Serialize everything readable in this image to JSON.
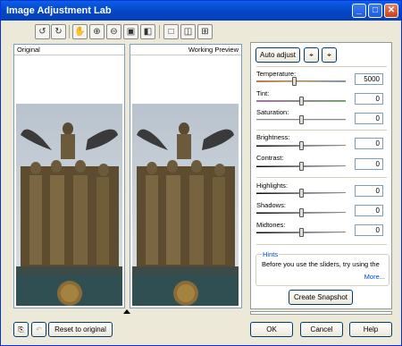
{
  "window": {
    "title": "Image Adjustment Lab"
  },
  "titlebar_buttons": {
    "minimize": "_",
    "maximize": "□",
    "close": "✕"
  },
  "toolbar": {
    "icons": [
      "rotate-left-icon",
      "rotate-right-icon",
      "hand-pan-icon",
      "zoom-in-icon",
      "zoom-out-icon",
      "fit-window-icon",
      "actual-size-icon",
      "single-view-icon",
      "split-view-icon",
      "side-by-side-icon"
    ]
  },
  "panes": {
    "original_label": "Original",
    "preview_label": "Working Preview"
  },
  "controls": {
    "auto_adjust": "Auto adjust",
    "temperature": {
      "label": "Temperature:",
      "value": "5000",
      "level": 0.42
    },
    "tint": {
      "label": "Tint:",
      "value": "0",
      "level": 0.5
    },
    "saturation": {
      "label": "Saturation:",
      "value": "0",
      "level": 0.5
    },
    "brightness": {
      "label": "Brightness:",
      "value": "0",
      "level": 0.5
    },
    "contrast": {
      "label": "Contrast:",
      "value": "0",
      "level": 0.5
    },
    "highlights": {
      "label": "Highlights:",
      "value": "0",
      "level": 0.5
    },
    "shadows": {
      "label": "Shadows:",
      "value": "0",
      "level": 0.5
    },
    "midtones": {
      "label": "Midtones:",
      "value": "0",
      "level": 0.5
    }
  },
  "hints": {
    "title": "Hints",
    "text": "Before you use the sliders, try using the",
    "more": "More..."
  },
  "buttons": {
    "create_snapshot": "Create Snapshot",
    "reset": "Reset to original",
    "ok": "OK",
    "cancel": "Cancel",
    "help": "Help"
  },
  "colors": {
    "titlebar": "#0546c8",
    "accent": "#0046d5",
    "dialog_bg": "#ece9d8"
  }
}
